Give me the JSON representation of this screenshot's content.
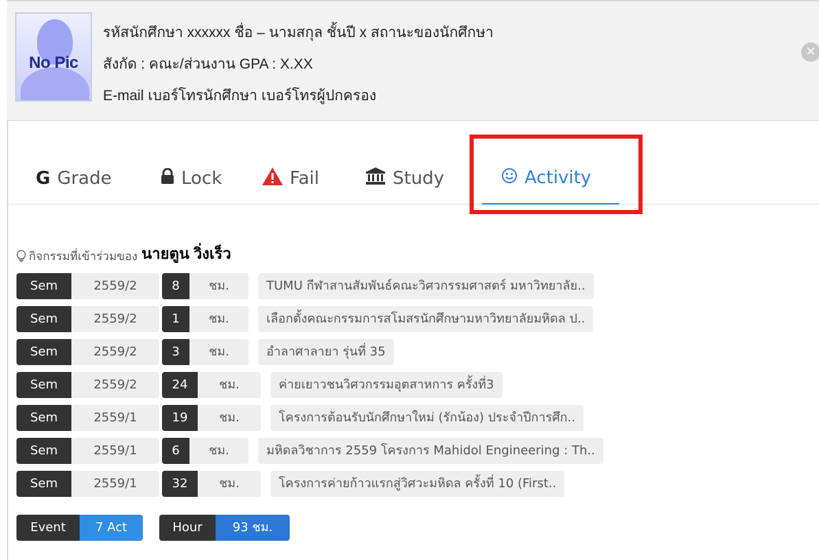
{
  "student": {
    "photo_label": "No Pic",
    "line1": "รหัสนักศึกษา xxxxxx ชื่อ – นามสกุล  ชั้นปี x  สถานะของนักศึกษา",
    "line2": "สังกัด : คณะ/ส่วนงาน   GPA : X.XX",
    "line3": "E-mail  เบอร์โทรนักศึกษา  เบอร์โทรผู้ปกครอง"
  },
  "tabs": [
    {
      "label": "Grade",
      "icon": "G"
    },
    {
      "label": "Lock",
      "icon": "lock-icon"
    },
    {
      "label": "Fail",
      "icon": "warning-icon"
    },
    {
      "label": "Study",
      "icon": "institution-icon"
    },
    {
      "label": "Activity",
      "icon": "smile-icon",
      "active": true
    }
  ],
  "activity": {
    "title": "กิจกรรมที่เข้าร่วมของ",
    "person": "นายตูน  วิ่งเร็ว",
    "rows": [
      {
        "sem_label": "Sem",
        "sem": "2559/2",
        "hours": "8",
        "unit": "ชม.",
        "title": "TUMU กีฬาสานสัมพันธ์คณะวิศวกรรมศาสตร์ มหาวิทยาลัย.."
      },
      {
        "sem_label": "Sem",
        "sem": "2559/2",
        "hours": "1",
        "unit": "ชม.",
        "title": "เลือกตั้งคณะกรรมการสโมสรนักศึกษามหาวิทยาลัยมหิดล ป.."
      },
      {
        "sem_label": "Sem",
        "sem": "2559/2",
        "hours": "3",
        "unit": "ชม.",
        "title": "อำลาศาลายา รุ่นที่ 35"
      },
      {
        "sem_label": "Sem",
        "sem": "2559/2",
        "hours": "24",
        "unit": "ชม.",
        "title": "ค่ายเยาวชนวิศวกรรมอุตสาหการ ครั้งที่3"
      },
      {
        "sem_label": "Sem",
        "sem": "2559/1",
        "hours": "19",
        "unit": "ชม.",
        "title": "โครงการต้อนรับนักศึกษาใหม่ (รักน้อง) ประจำปีการศึก.."
      },
      {
        "sem_label": "Sem",
        "sem": "2559/1",
        "hours": "6",
        "unit": "ชม.",
        "title": "มหิดลวิชาการ 2559 โครงการ Mahidol Engineering : Th.."
      },
      {
        "sem_label": "Sem",
        "sem": "2559/1",
        "hours": "32",
        "unit": "ชม.",
        "title": "โครงการค่ายก้าวแรกสู่วิศวะมหิดล ครั้งที่ 10 (First.."
      }
    ],
    "summary": {
      "event_label": "Event",
      "event_value": "7 Act",
      "hour_label": "Hour",
      "hour_value": "93 ชม."
    }
  },
  "colors": {
    "accent": "#2f7ed8",
    "highlight_box": "#ee1c1c",
    "dark_label": "#333333",
    "light_value": "#eeeeee"
  }
}
